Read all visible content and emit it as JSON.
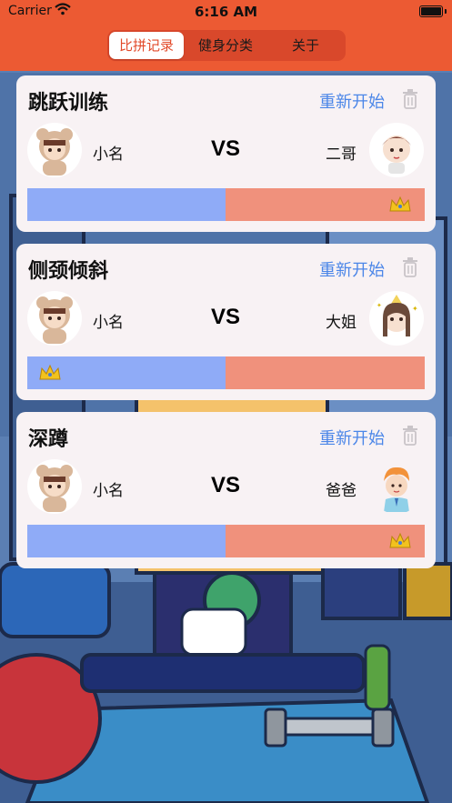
{
  "status_bar": {
    "carrier": "Carrier",
    "time": "6:16 AM"
  },
  "tabs": [
    {
      "label": "比拼记录",
      "active": true
    },
    {
      "label": "健身分类",
      "active": false
    },
    {
      "label": "关于",
      "active": false
    }
  ],
  "colors": {
    "accent": "#ec5a33",
    "link": "#4b86e8",
    "left_bar": "#8fabf7",
    "right_bar": "#f0917c",
    "card_bg": "#f8f2f4"
  },
  "cards": [
    {
      "title": "跳跃训练",
      "restart_label": "重新开始",
      "left_name": "小名",
      "vs_label": "VS",
      "right_name": "二哥",
      "left_share": 0.5,
      "winner": "right"
    },
    {
      "title": "侧颈倾斜",
      "restart_label": "重新开始",
      "left_name": "小名",
      "vs_label": "VS",
      "right_name": "大姐",
      "left_share": 0.5,
      "winner": "left"
    },
    {
      "title": "深蹲",
      "restart_label": "重新开始",
      "left_name": "小名",
      "vs_label": "VS",
      "right_name": "爸爸",
      "left_share": 0.5,
      "winner": "right"
    }
  ]
}
